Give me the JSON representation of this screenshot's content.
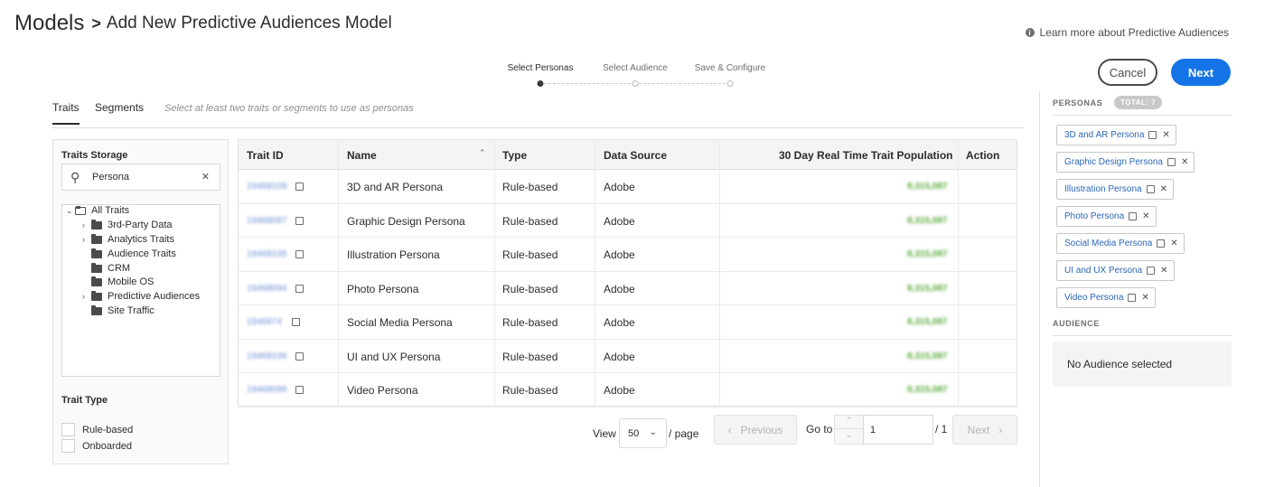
{
  "header": {
    "crumb_root": "Models",
    "crumb_separator": ">",
    "page_title": "Add New Predictive Audiences Model",
    "learn_more": "Learn more about Predictive Audiences"
  },
  "stepper": {
    "steps": [
      "Select Personas",
      "Select Audience",
      "Save & Configure"
    ],
    "active_index": 0
  },
  "actions": {
    "cancel": "Cancel",
    "next": "Next"
  },
  "tabs": {
    "items": [
      "Traits",
      "Segments"
    ],
    "active": "Traits",
    "hint": "Select at least two traits or segments to use as personas"
  },
  "traits_storage": {
    "title": "Traits Storage",
    "search_value": "Persona",
    "tree": [
      {
        "label": "All Traits",
        "expandable": true,
        "expanded": true
      },
      {
        "label": "3rd-Party Data",
        "expandable": true
      },
      {
        "label": "Analytics Traits",
        "expandable": true
      },
      {
        "label": "Audience Traits",
        "expandable": false
      },
      {
        "label": "CRM",
        "expandable": false
      },
      {
        "label": "Mobile OS",
        "expandable": false
      },
      {
        "label": "Predictive Audiences",
        "expandable": true
      },
      {
        "label": "Site Traffic",
        "expandable": false
      }
    ],
    "trait_type_title": "Trait Type",
    "trait_types": [
      "Rule-based",
      "Onboarded"
    ]
  },
  "table": {
    "columns": [
      "Trait ID",
      "Name",
      "Type",
      "Data Source",
      "30 Day Real Time Trait Population",
      "Action"
    ],
    "rows": [
      {
        "id": "19468109",
        "name": "3D and AR Persona",
        "type": "Rule-based",
        "source": "Adobe",
        "population": "8,315,087"
      },
      {
        "id": "19468097",
        "name": "Graphic Design Persona",
        "type": "Rule-based",
        "source": "Adobe",
        "population": "8,315,087"
      },
      {
        "id": "19468105",
        "name": "Illustration Persona",
        "type": "Rule-based",
        "source": "Adobe",
        "population": "8,315,087"
      },
      {
        "id": "19468094",
        "name": "Photo Persona",
        "type": "Rule-based",
        "source": "Adobe",
        "population": "8,315,087"
      },
      {
        "id": "1946874",
        "name": "Social Media Persona",
        "type": "Rule-based",
        "source": "Adobe",
        "population": "8,315,087"
      },
      {
        "id": "19468106",
        "name": "UI and UX Persona",
        "type": "Rule-based",
        "source": "Adobe",
        "population": "8,315,087"
      },
      {
        "id": "19468099",
        "name": "Video Persona",
        "type": "Rule-based",
        "source": "Adobe",
        "population": "8,315,087"
      }
    ]
  },
  "pagination": {
    "view_label": "View",
    "page_size": "50",
    "per_page_label": "/ page",
    "previous": "Previous",
    "goto_label": "Go to",
    "current_page": "1",
    "total_pages": "/ 1",
    "next": "Next"
  },
  "personas_panel": {
    "title": "PERSONAS",
    "total_badge": "TOTAL: 7",
    "chips": [
      "3D and AR Persona",
      "Graphic Design Persona",
      "Illustration Persona",
      "Photo Persona",
      "Social Media Persona",
      "UI and UX Persona",
      "Video Persona"
    ],
    "audience_title": "AUDIENCE",
    "audience_empty": "No Audience selected"
  },
  "colors": {
    "primary": "#1473e6",
    "link": "#2c66b8",
    "population": "#5aaa3c"
  }
}
